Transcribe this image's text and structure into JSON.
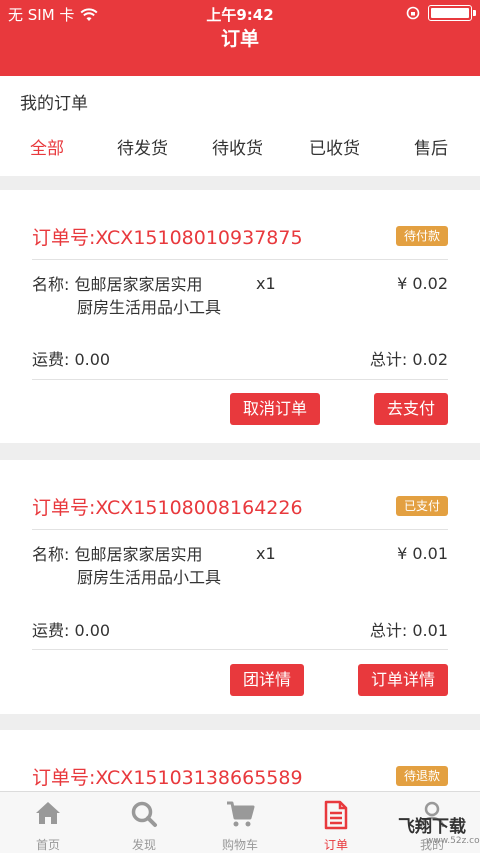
{
  "status_bar": {
    "carrier": "无 SIM 卡",
    "time": "上午9:42"
  },
  "nav": {
    "title": "订单"
  },
  "section": {
    "title": "我的订单"
  },
  "tabs": [
    {
      "label": "全部",
      "active": true
    },
    {
      "label": "待发货"
    },
    {
      "label": "待收货"
    },
    {
      "label": "已收货"
    },
    {
      "label": "售后"
    }
  ],
  "orders": [
    {
      "order_no": "订单号:XCX15108010937875",
      "status": "待付款",
      "item_name_line1": "名称: 包邮居家家居实用",
      "item_name_line2": "厨房生活用品小工具",
      "qty": "x1",
      "price": "¥ 0.02",
      "freight": "运费: 0.00",
      "total": "总计: 0.02",
      "buttons": [
        "取消订单",
        "去支付"
      ]
    },
    {
      "order_no": "订单号:XCX15108008164226",
      "status": "已支付",
      "item_name_line1": "名称: 包邮居家家居实用",
      "item_name_line2": "厨房生活用品小工具",
      "qty": "x1",
      "price": "¥ 0.01",
      "freight": "运费: 0.00",
      "total": "总计: 0.01",
      "buttons": [
        "团详情",
        "订单详情"
      ]
    },
    {
      "order_no": "订单号:XCX15103138665589",
      "status": "待退款"
    }
  ],
  "tabbar": [
    {
      "label": "首页",
      "icon": "home-icon"
    },
    {
      "label": "发现",
      "icon": "search-icon"
    },
    {
      "label": "购物车",
      "icon": "cart-icon"
    },
    {
      "label": "订单",
      "icon": "order-icon",
      "active": true
    },
    {
      "label": "我的",
      "icon": "user-icon"
    }
  ],
  "watermark": {
    "text": "飞翔下载",
    "url": "www.52z.com"
  },
  "colors": {
    "accent": "#e8393d",
    "badge": "#e3a041"
  }
}
